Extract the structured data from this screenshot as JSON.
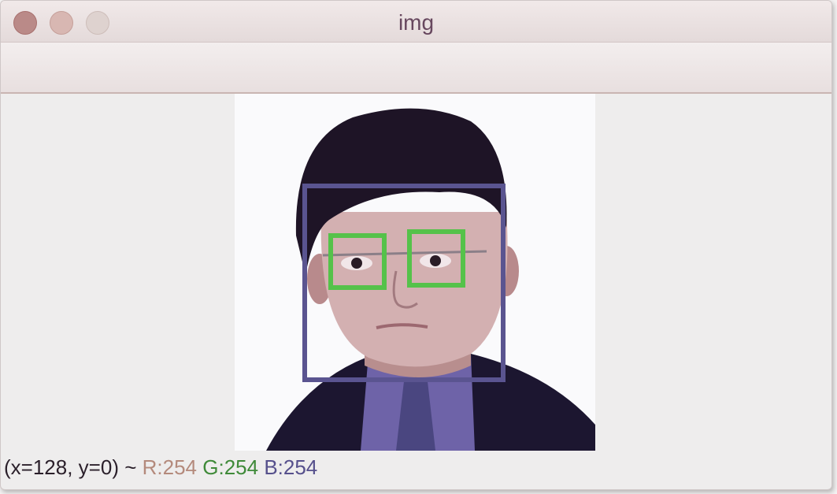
{
  "window": {
    "title": "img"
  },
  "status": {
    "coords": "(x=128, y=0) ~",
    "r": "R:254",
    "g": "G:254",
    "b": "B:254"
  },
  "colors": {
    "face_box": "#5a5490",
    "eye_box": "#55c24a"
  }
}
